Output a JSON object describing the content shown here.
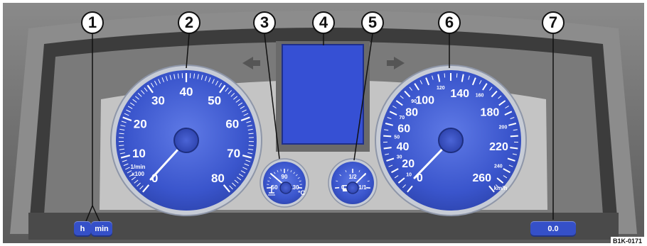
{
  "callouts": [
    "1",
    "2",
    "3",
    "4",
    "5",
    "6",
    "7"
  ],
  "tachometer": {
    "ticks": [
      "0",
      "10",
      "20",
      "30",
      "40",
      "50",
      "60",
      "70",
      "80"
    ],
    "unit_line1": "1/min",
    "unit_line2": "x100"
  },
  "coolant": {
    "ticks": [
      "50",
      "90",
      "130"
    ],
    "unit": "°C"
  },
  "fuel": {
    "ticks": [
      "0",
      "1/2",
      "1/1"
    ]
  },
  "speedometer": {
    "major_ticks": [
      "0",
      "20",
      "40",
      "60",
      "80",
      "100",
      "140",
      "180",
      "220",
      "260"
    ],
    "minor_ticks": [
      "10",
      "30",
      "50",
      "70",
      "90",
      "120",
      "160",
      "200",
      "240"
    ],
    "unit": "km/h"
  },
  "buttons": {
    "hours": "h",
    "minutes": "min",
    "reset": "0.0"
  },
  "reference_code": "B1K-0171",
  "colors": {
    "dial_blue": "#3a55cc",
    "display_blue": "#3650d4",
    "dial_ring": "#c7ccd6",
    "housing": "#6e6e6e"
  }
}
